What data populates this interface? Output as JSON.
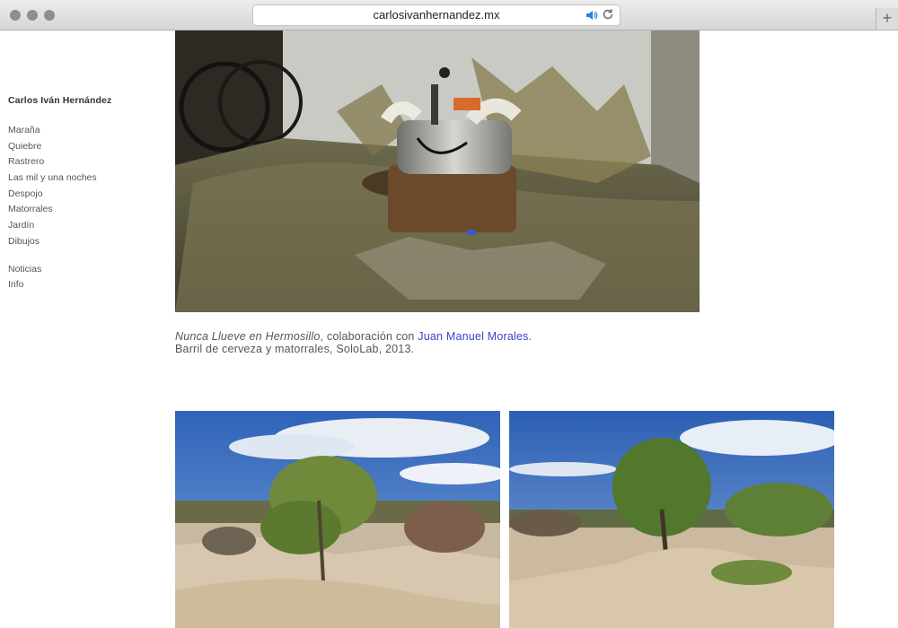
{
  "browser": {
    "url": "carlosivanhernandez.mx",
    "new_tab_symbol": "+"
  },
  "site": {
    "title": "Carlos Iván Hernández"
  },
  "nav": {
    "primary": [
      "Maraña",
      "Quiebre",
      "Rastrero",
      "Las mil y una noches",
      "Despojo",
      "Matorrales",
      "Jardín",
      "Dibujos"
    ],
    "secondary": [
      "Noticias",
      "Info"
    ]
  },
  "caption": {
    "work_title": "Nunca Llueve en Hermosillo",
    "collab_text": ", colaboración con ",
    "collaborator": "Juan Manuel Morales",
    "period": ".",
    "line2": "Barril de cerveza y matorrales, SoloLab, 2013."
  },
  "colors": {
    "link": "#3a3fc8",
    "nav_text": "#555555"
  }
}
